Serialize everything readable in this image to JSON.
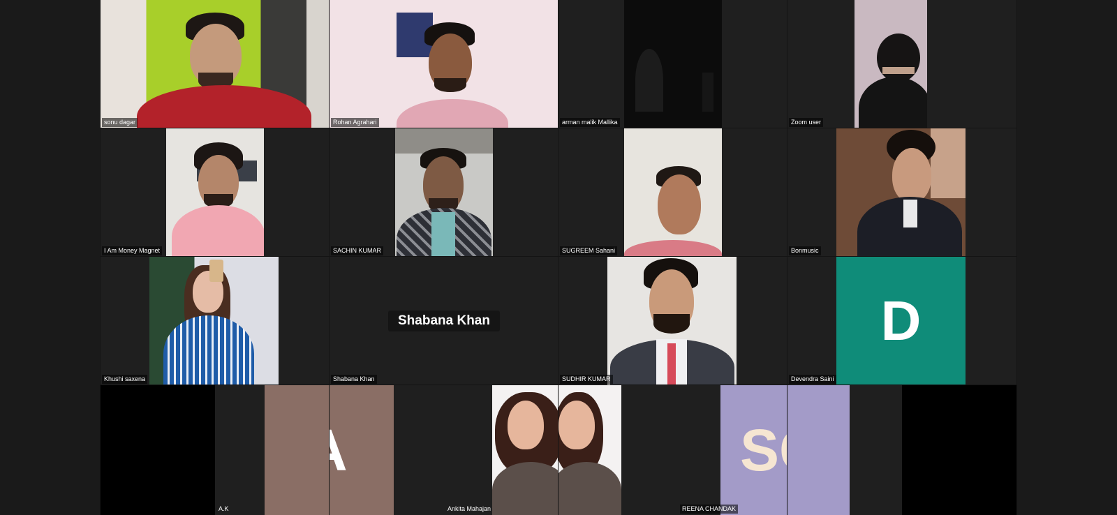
{
  "meeting": {
    "participants": [
      {
        "name": "sonu dagar"
      },
      {
        "name": "Rohan Agrahari"
      },
      {
        "name": "arman malik Mallika"
      },
      {
        "name": "Zoom user"
      },
      {
        "name": "I Am Money Magnet"
      },
      {
        "name": "SACHIN KUMAR"
      },
      {
        "name": "SUGREEM Sahani"
      },
      {
        "name": "Bonmusic"
      },
      {
        "name": "Khushi saxena"
      },
      {
        "name": "Shabana Khan"
      },
      {
        "name": "SUDHIR KUMAR"
      },
      {
        "name": "Devendra Saini"
      },
      {
        "name": "A.K",
        "initials": "A"
      },
      {
        "name": "Ankita Mahajan"
      },
      {
        "name": "REENA CHANDAK",
        "initials": "SC"
      }
    ],
    "devendra_initial": "D",
    "shabana_display": "Shabana Khan",
    "colors": {
      "background": "#1a1a1a",
      "avatar_devendra": "#0f8c79",
      "avatar_ak": "#8a6e65",
      "avatar_reena": "#a39bc8",
      "avatar_reena_text": "#f6e6d2"
    }
  }
}
